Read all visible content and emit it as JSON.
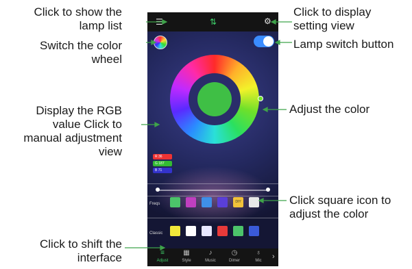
{
  "annotations": {
    "lamp_list": [
      "Click to show the",
      "lamp list"
    ],
    "color_wheel": [
      "Switch the color",
      "wheel"
    ],
    "rgb_value": [
      "Display the RGB",
      "value Click to",
      "manual adjustment",
      "view"
    ],
    "shift_interface": [
      "Click to shift the",
      "interface"
    ],
    "setting_view": [
      "Click to display",
      "setting view"
    ],
    "lamp_switch": "Lamp switch button",
    "adjust_color": "Adjust the color",
    "square_icon": [
      "Click square icon to",
      "adjust the color"
    ]
  },
  "phone": {
    "rgb": {
      "r": "R 36",
      "g": "G 187",
      "b": "B 71"
    },
    "rows": {
      "preset_label": "Freqs",
      "classic_label": "Classic"
    },
    "preset_colors": [
      "#4cc36a",
      "#c03fc0",
      "#3f8fe8",
      "#5a3fd8",
      "#f2c23a",
      "#e8e8e8"
    ],
    "preset_diy_label": "DIY",
    "classic_colors": [
      "#f2e83a",
      "#ffffff",
      "#e8e8ff",
      "#e83a3a",
      "#4cc36a",
      "#3a5ad8"
    ],
    "nav": [
      {
        "label": "Adjust",
        "icon": "adjust-icon",
        "glyph": "≡"
      },
      {
        "label": "Style",
        "icon": "style-icon",
        "glyph": "▦"
      },
      {
        "label": "Music",
        "icon": "music-icon",
        "glyph": "♪"
      },
      {
        "label": "Dimer",
        "icon": "timer-icon",
        "glyph": "◷"
      },
      {
        "label": "Mic",
        "icon": "mic-icon",
        "glyph": "♁"
      }
    ],
    "nav_more": "›",
    "accent": "#3fd06a",
    "toggle_color": "#3a8cff"
  }
}
